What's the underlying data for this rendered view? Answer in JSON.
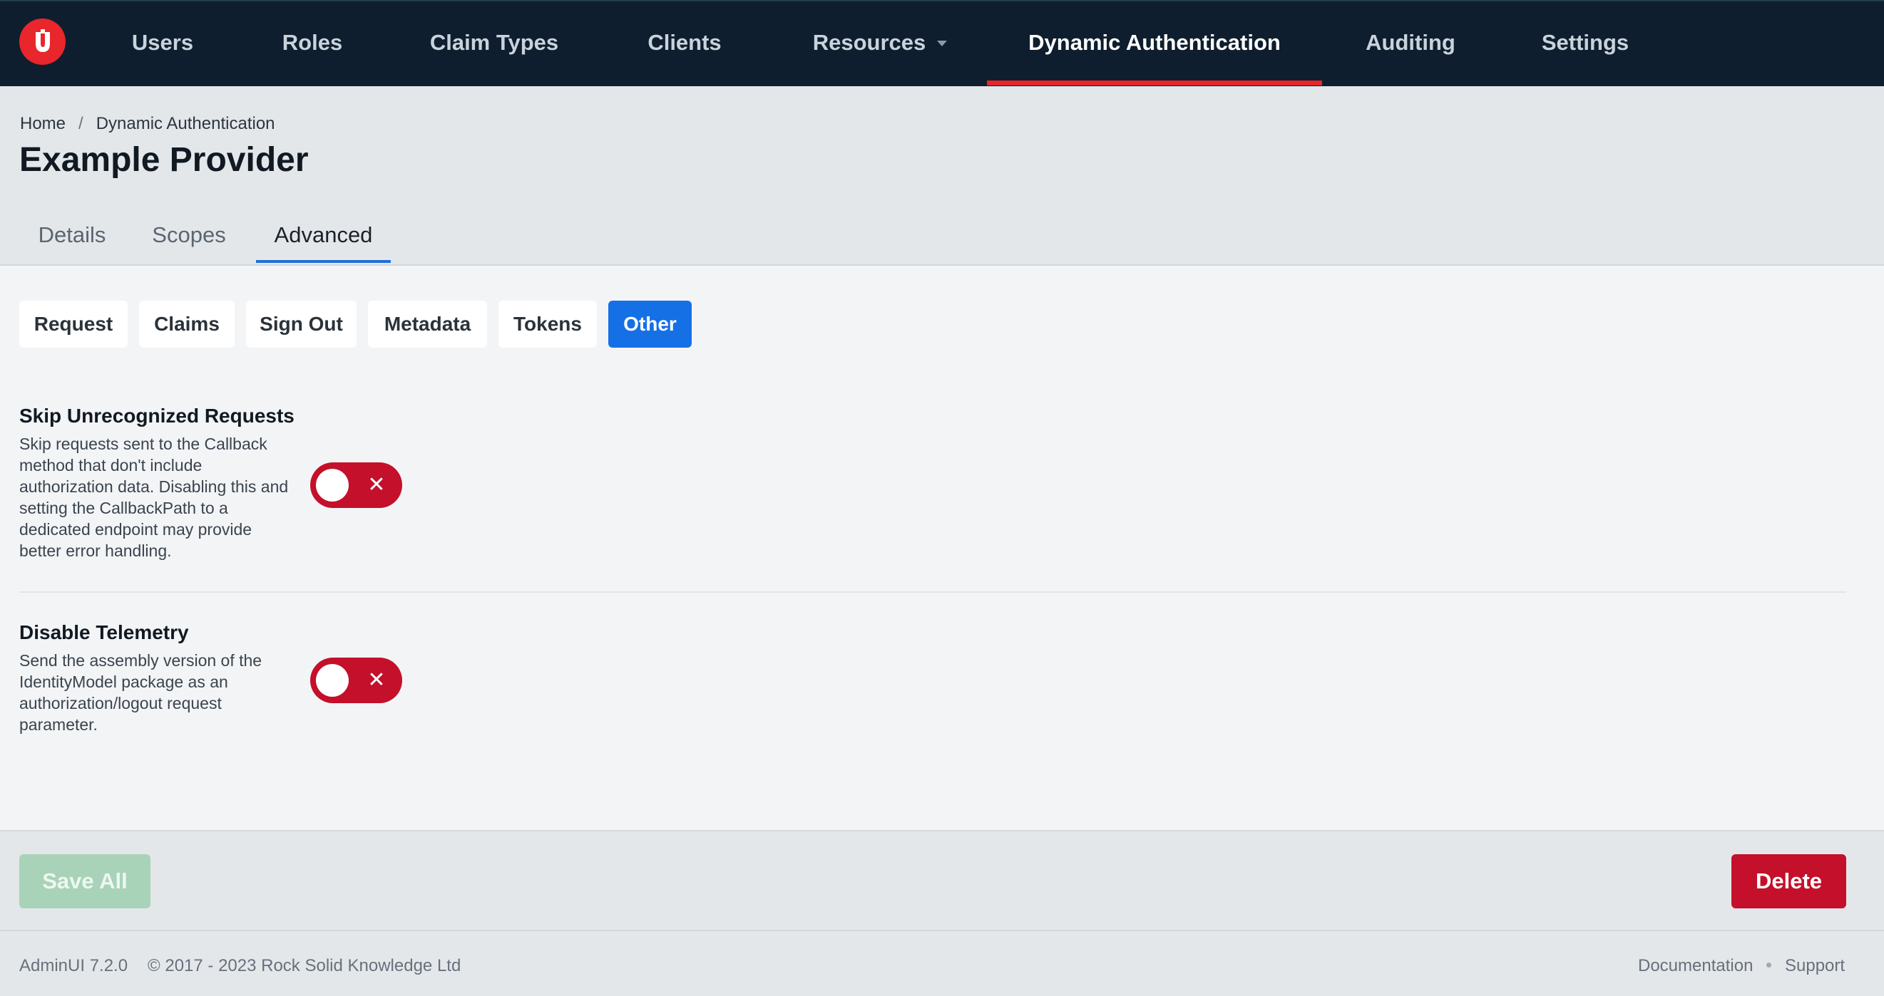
{
  "nav": {
    "logo_letter": "U",
    "items": [
      {
        "label": "Users"
      },
      {
        "label": "Roles"
      },
      {
        "label": "Claim Types"
      },
      {
        "label": "Clients"
      },
      {
        "label": "Resources",
        "has_dropdown": true
      },
      {
        "label": "Dynamic Authentication",
        "active": true
      },
      {
        "label": "Auditing"
      },
      {
        "label": "Settings"
      }
    ]
  },
  "breadcrumb": {
    "home": "Home",
    "separator": "/",
    "current": "Dynamic Authentication"
  },
  "page_title": "Example Provider",
  "tabs": [
    {
      "label": "Details"
    },
    {
      "label": "Scopes"
    },
    {
      "label": "Advanced",
      "active": true
    }
  ],
  "subtabs": [
    {
      "label": "Request"
    },
    {
      "label": "Claims"
    },
    {
      "label": "Sign Out"
    },
    {
      "label": "Metadata"
    },
    {
      "label": "Tokens"
    },
    {
      "label": "Other",
      "active": true
    }
  ],
  "settings": [
    {
      "title": "Skip Unrecognized Requests",
      "description": "Skip requests sent to the Callback method that don't include authorization data. Disabling this and setting the CallbackPath to a dedicated endpoint may provide better error handling.",
      "enabled": false,
      "toggle_icon": "✕"
    },
    {
      "title": "Disable Telemetry",
      "description": "Send the assembly version of the IdentityModel package as an authorization/logout request parameter.",
      "enabled": false,
      "toggle_icon": "✕"
    }
  ],
  "actions": {
    "save_label": "Save All",
    "save_disabled": true,
    "delete_label": "Delete"
  },
  "footer": {
    "version": "AdminUI 7.2.0",
    "copyright": "© 2017 - 2023 Rock Solid Knowledge Ltd",
    "documentation": "Documentation",
    "support": "Support"
  },
  "colors": {
    "nav_bg": "#0e1e2e",
    "accent_red": "#e8262b",
    "primary_blue": "#1570e6",
    "toggle_off": "#c4102a",
    "save_disabled": "#a8d3b8"
  }
}
